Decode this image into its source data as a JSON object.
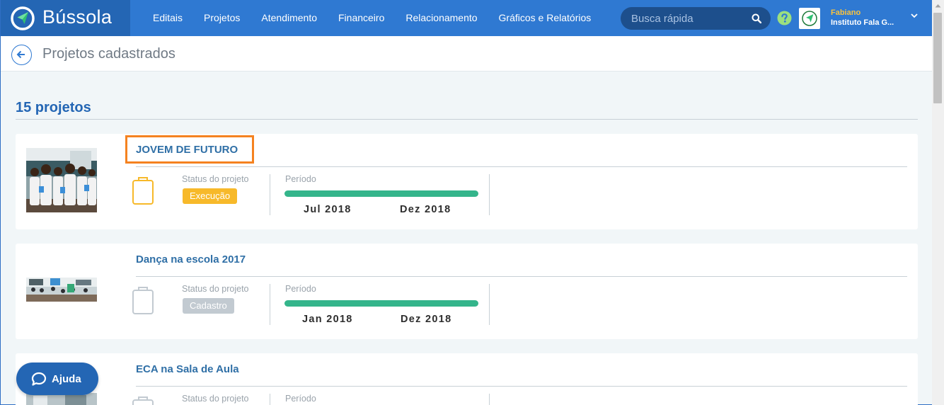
{
  "app": {
    "name": "Bússola"
  },
  "nav": {
    "items": [
      {
        "label": "Editais"
      },
      {
        "label": "Projetos"
      },
      {
        "label": "Atendimento"
      },
      {
        "label": "Financeiro"
      },
      {
        "label": "Relacionamento"
      },
      {
        "label": "Gráficos e Relatórios"
      }
    ],
    "search_placeholder": "Busca rápida",
    "search_icon": "search-icon",
    "help_icon": "question-circle-icon"
  },
  "user": {
    "name": "Fabiano",
    "organization": "Instituto Fala G...",
    "menu_icon": "chevron-down-icon"
  },
  "page": {
    "title": "Projetos cadastrados",
    "back_icon": "arrow-left-icon",
    "count_label": "15 projetos"
  },
  "projects": [
    {
      "title": "JOVEM DE FUTURO",
      "status_label": "Status do projeto",
      "status": "Execução",
      "status_color": "#f7b92a",
      "period_label": "Período",
      "period_start": "Jul 2018",
      "period_end": "Dez 2018"
    },
    {
      "title": "Dança na escola 2017",
      "status_label": "Status do projeto",
      "status": "Cadastro",
      "status_color": "#c2cad1",
      "period_label": "Período",
      "period_start": "Jan 2018",
      "period_end": "Dez 2018"
    },
    {
      "title": "ECA na Sala de Aula",
      "status_label": "Status do projeto",
      "period_label": "Período"
    }
  ],
  "help": {
    "label": "Ajuda",
    "icon": "chat-bubble-icon"
  },
  "colors": {
    "header": "#2f79d2",
    "brand": "#2466b4",
    "period_bar": "#34b58b",
    "highlight": "#f58220"
  }
}
